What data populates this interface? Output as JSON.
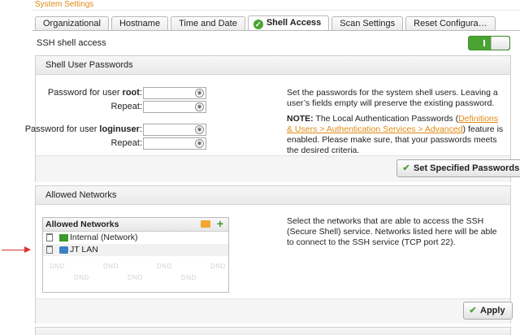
{
  "header": {
    "section_title": "System Settings"
  },
  "tabs": [
    {
      "label": "Organizational"
    },
    {
      "label": "Hostname"
    },
    {
      "label": "Time and Date"
    },
    {
      "label": "Shell Access",
      "active": true
    },
    {
      "label": "Scan Settings"
    },
    {
      "label": "Reset Configura…"
    }
  ],
  "ssh": {
    "label": "SSH shell access",
    "toggle_state": "on",
    "toggle_color": "#4aa432"
  },
  "passwords": {
    "title": "Shell User Passwords",
    "root_label_prefix": "Password for user ",
    "root_user": "root",
    "root_label_suffix": ":",
    "repeat_label": "Repeat:",
    "loginuser_label_prefix": "Password for user ",
    "loginuser_user": "loginuser",
    "loginuser_label_suffix": ":",
    "desc1": "Set the passwords for the system shell users. Leaving a user’s fields empty will preserve the existing password.",
    "note_bold": "NOTE:",
    "note_pre": " The Local Authentication Passwords (",
    "note_link": "Definitions & Users > Authentication Services > Advanced",
    "note_post": ") feature is enabled. Please make sure, that your passwords meets the desired criteria.",
    "button_label": "Set Specified Passwords"
  },
  "allowed": {
    "title": "Allowed Networks",
    "list_title": "Allowed Networks",
    "items": [
      {
        "label": "Internal (Network)",
        "icon": "network-icon"
      },
      {
        "label": "JT LAN",
        "icon": "lan-icon"
      }
    ],
    "dnd_text": "DND",
    "desc": "Select the networks that are able to access the SSH (Secure Shell) service. Networks listed here will be able to connect to the SSH service (TCP port 22).",
    "apply_label": "Apply"
  },
  "colors": {
    "accent_orange": "#e08a14",
    "accent_green": "#4aa432",
    "annotation_red": "#d33333"
  }
}
